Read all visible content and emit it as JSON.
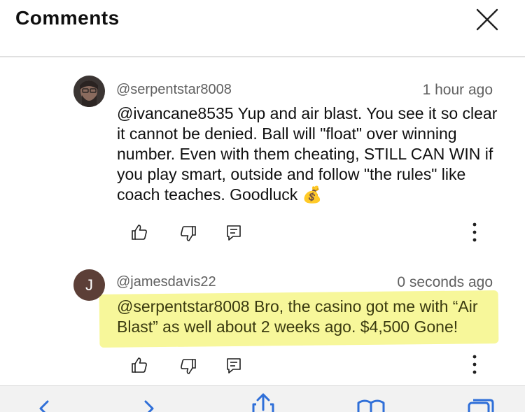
{
  "header": {
    "title": "Comments"
  },
  "comments": [
    {
      "author": "@serpentstar8008",
      "time": "1 hour ago",
      "mention": "@ivancane8535",
      "text": " Yup and air blast. You see it so clear it cannot be denied. Ball will \"float\" over winning number. Even with them cheating, STILL CAN WIN if you play smart, outside and follow \"the rules\" like coach teaches. Goodluck ",
      "emoji": "💰"
    },
    {
      "author": "@jamesdavis22",
      "time": "0 seconds ago",
      "avatar_letter": "J",
      "text": "@serpentstar8008 Bro, the casino got me with “Air Blast” as well about 2 weeks ago. $4,500 Gone!"
    }
  ],
  "icons": {
    "close": "close-icon",
    "like": "thumbs-up-icon",
    "dislike": "thumbs-down-icon",
    "reply": "reply-icon",
    "more": "more-vertical-icon",
    "back": "chevron-left-icon",
    "forward": "chevron-right-icon",
    "share": "share-icon",
    "bookmarks": "book-icon",
    "tabs": "tabs-icon"
  },
  "colors": {
    "highlight": "#f7f79a",
    "avatar_j": "#5c3f37"
  }
}
